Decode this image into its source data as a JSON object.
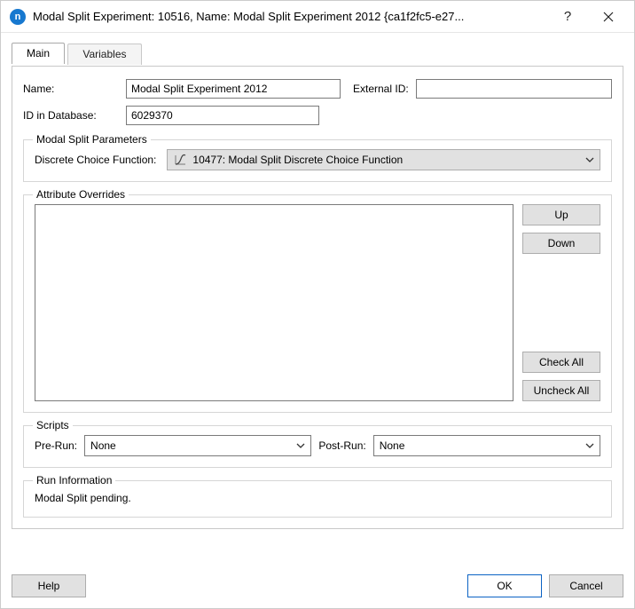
{
  "window": {
    "title": "Modal Split Experiment: 10516, Name: Modal Split Experiment 2012  {ca1f2fc5-e27..."
  },
  "tabs": {
    "main": "Main",
    "variables": "Variables"
  },
  "form": {
    "name_label": "Name:",
    "name_value": "Modal Split Experiment 2012",
    "external_id_label": "External ID:",
    "external_id_value": "",
    "db_id_label": "ID in Database:",
    "db_id_value": "6029370"
  },
  "params": {
    "legend": "Modal Split Parameters",
    "dcf_label": "Discrete Choice Function:",
    "dcf_selected": "10477: Modal Split Discrete Choice Function"
  },
  "attr": {
    "legend": "Attribute Overrides",
    "buttons": {
      "up": "Up",
      "down": "Down",
      "check_all": "Check All",
      "uncheck_all": "Uncheck All"
    }
  },
  "scripts": {
    "legend": "Scripts",
    "pre_label": "Pre-Run:",
    "pre_selected": "None",
    "post_label": "Post-Run:",
    "post_selected": "None"
  },
  "runinfo": {
    "legend": "Run Information",
    "text": "Modal Split pending."
  },
  "footer": {
    "help": "Help",
    "ok": "OK",
    "cancel": "Cancel"
  },
  "icons": {
    "app_letter": "n"
  }
}
